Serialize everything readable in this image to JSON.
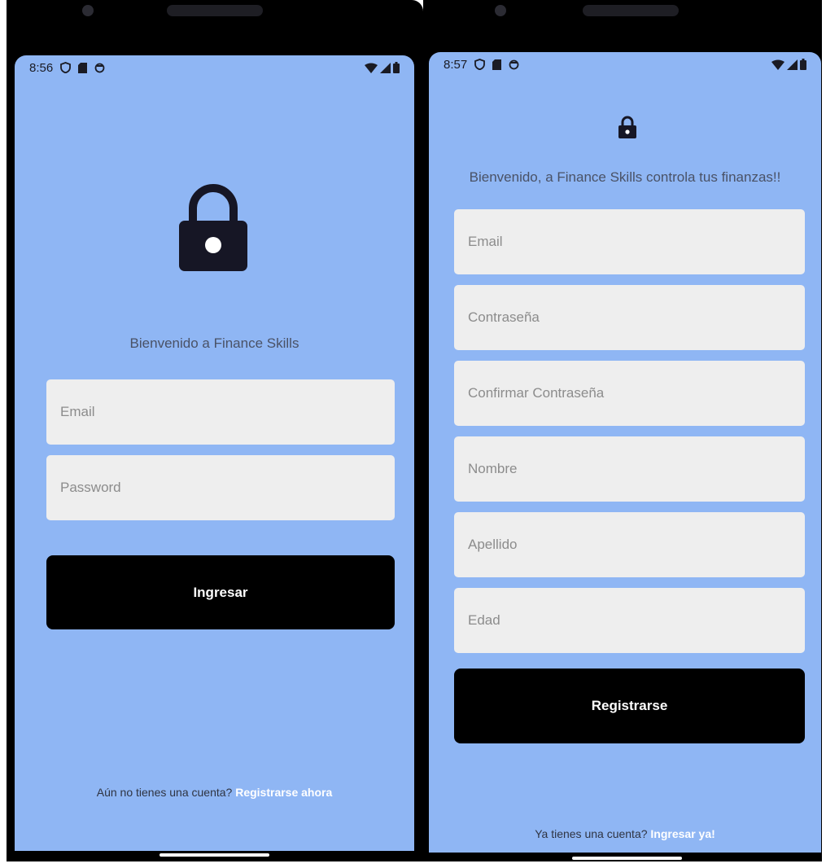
{
  "login_screen": {
    "status_bar": {
      "time": "8:56",
      "icons": [
        "shield-icon",
        "sd-card-icon",
        "sync-icon"
      ],
      "right_icons": [
        "wifi-icon",
        "signal-icon",
        "battery-icon"
      ]
    },
    "icon": "lock-icon",
    "welcome_text": "Bienvenido a Finance Skills",
    "fields": {
      "email_placeholder": "Email",
      "password_placeholder": "Password"
    },
    "submit_label": "Ingresar",
    "footer": {
      "prompt": "Aún no tienes una cuenta?",
      "link": "Registrarse ahora"
    }
  },
  "register_screen": {
    "status_bar": {
      "time": "8:57",
      "icons": [
        "shield-icon",
        "sd-card-icon",
        "sync-icon"
      ],
      "right_icons": [
        "wifi-icon",
        "signal-icon",
        "battery-icon"
      ]
    },
    "icon": "lock-icon",
    "welcome_text": "Bienvenido, a Finance Skills controla tus finanzas!!",
    "fields": {
      "email_placeholder": "Email",
      "password_placeholder": "Contraseña",
      "confirm_password_placeholder": "Confirmar Contraseña",
      "first_name_placeholder": "Nombre",
      "last_name_placeholder": "Apellido",
      "age_placeholder": "Edad"
    },
    "submit_label": "Registrarse",
    "footer": {
      "prompt": "Ya tienes una cuenta?",
      "link": "Ingresar ya!"
    }
  },
  "colors": {
    "screen_background": "#8fb6f4",
    "field_background": "#eeeeee",
    "button_background": "#000000",
    "button_text": "#ffffff",
    "link_text": "#ffffff"
  }
}
